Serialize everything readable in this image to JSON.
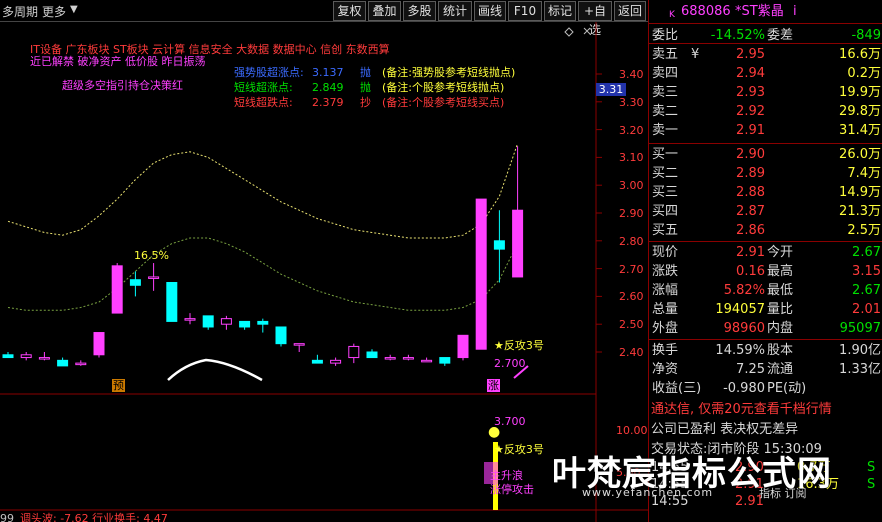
{
  "toolbar": {
    "period": "多周期",
    "more": "更多",
    "buttons": [
      "复权",
      "叠加",
      "多股",
      "统计",
      "画线",
      "F10",
      "标记",
      "+自选",
      "返回"
    ]
  },
  "chart": {
    "news_line1": "IT设备    广东板块  ST板块  云计算  信息安全  大数据  数据中心  信创  东数西算",
    "news_line2": "近已解禁  破净资产  低价股  昨日振荡",
    "indicator_tag": "超级多空指引持仓决策红",
    "levels": [
      {
        "label": "强势股超涨点:",
        "value": "3.137",
        "mark": "抛",
        "note": "(备注:强势股参考短线抛点)",
        "color": "#3b6bff"
      },
      {
        "label": "短线超涨点:",
        "value": "2.849",
        "mark": "抛",
        "note": "(备注:个股参考短线抛点)",
        "color": "#00e000"
      },
      {
        "label": "短线超跌点:",
        "value": "2.379",
        "mark": "抄",
        "note": "(备注:个股参考短线买点)",
        "color": "#ff3b3b"
      }
    ],
    "price_axis": [
      "3.40",
      "3.30",
      "3.20",
      "3.10",
      "3.00",
      "2.90",
      "2.80",
      "2.70",
      "2.60",
      "2.50",
      "2.40"
    ],
    "cursor_price": "3.31",
    "peak_label": "16.5%",
    "signal1": "反攻3号",
    "signal1_price": "2.700",
    "pre_tag": "预",
    "up_tag": "涨",
    "lower_axis": [
      "10.00",
      "5.00"
    ],
    "lower_price": "3.700",
    "lower_signal": "反攻3号",
    "lower_text1": "主升浪",
    "lower_text2": "涨停攻击",
    "footer": "调头波: -7.62  行业换手: 4.47",
    "footer_left": "99"
  },
  "chart_data": {
    "type": "candlestick",
    "ylim": [
      2.35,
      3.45
    ],
    "candles": [
      {
        "o": 2.39,
        "h": 2.4,
        "l": 2.38,
        "c": 2.38
      },
      {
        "o": 2.38,
        "h": 2.4,
        "l": 2.37,
        "c": 2.39
      },
      {
        "o": 2.38,
        "h": 2.4,
        "l": 2.37,
        "c": 2.38
      },
      {
        "o": 2.37,
        "h": 2.38,
        "l": 2.35,
        "c": 2.35
      },
      {
        "o": 2.36,
        "h": 2.37,
        "l": 2.35,
        "c": 2.36
      },
      {
        "o": 2.39,
        "h": 2.47,
        "l": 2.38,
        "c": 2.47
      },
      {
        "o": 2.54,
        "h": 2.72,
        "l": 2.54,
        "c": 2.71
      },
      {
        "o": 2.66,
        "h": 2.69,
        "l": 2.6,
        "c": 2.64
      },
      {
        "o": 2.67,
        "h": 2.72,
        "l": 2.62,
        "c": 2.67
      },
      {
        "o": 2.65,
        "h": 2.65,
        "l": 2.51,
        "c": 2.51
      },
      {
        "o": 2.52,
        "h": 2.54,
        "l": 2.5,
        "c": 2.52
      },
      {
        "o": 2.53,
        "h": 2.53,
        "l": 2.48,
        "c": 2.49
      },
      {
        "o": 2.5,
        "h": 2.53,
        "l": 2.48,
        "c": 2.52
      },
      {
        "o": 2.51,
        "h": 2.51,
        "l": 2.48,
        "c": 2.49
      },
      {
        "o": 2.51,
        "h": 2.52,
        "l": 2.47,
        "c": 2.5
      },
      {
        "o": 2.49,
        "h": 2.49,
        "l": 2.42,
        "c": 2.43
      },
      {
        "o": 2.43,
        "h": 2.43,
        "l": 2.4,
        "c": 2.43
      },
      {
        "o": 2.37,
        "h": 2.39,
        "l": 2.36,
        "c": 2.36
      },
      {
        "o": 2.36,
        "h": 2.38,
        "l": 2.35,
        "c": 2.37
      },
      {
        "o": 2.38,
        "h": 2.43,
        "l": 2.36,
        "c": 2.42
      },
      {
        "o": 2.4,
        "h": 2.41,
        "l": 2.38,
        "c": 2.38
      },
      {
        "o": 2.38,
        "h": 2.39,
        "l": 2.37,
        "c": 2.38
      },
      {
        "o": 2.38,
        "h": 2.39,
        "l": 2.37,
        "c": 2.38
      },
      {
        "o": 2.37,
        "h": 2.38,
        "l": 2.37,
        "c": 2.37
      },
      {
        "o": 2.38,
        "h": 2.38,
        "l": 2.35,
        "c": 2.36
      },
      {
        "o": 2.38,
        "h": 2.46,
        "l": 2.37,
        "c": 2.46
      },
      {
        "o": 2.41,
        "h": 2.95,
        "l": 2.41,
        "c": 2.95
      },
      {
        "o": 2.8,
        "h": 2.91,
        "l": 2.65,
        "c": 2.77
      },
      {
        "o": 2.67,
        "h": 3.14,
        "l": 2.67,
        "c": 2.91
      }
    ],
    "upper_band": [
      2.87,
      2.85,
      2.83,
      2.82,
      2.84,
      2.89,
      2.95,
      3.02,
      3.08,
      3.11,
      3.12,
      3.1,
      3.06,
      3.02,
      2.98,
      2.94,
      2.91,
      2.88,
      2.86,
      2.84,
      2.83,
      2.82,
      2.81,
      2.81,
      2.81,
      2.82,
      2.86,
      2.96,
      3.15
    ],
    "lower_band": [
      2.56,
      2.55,
      2.55,
      2.55,
      2.56,
      2.58,
      2.63,
      2.69,
      2.75,
      2.79,
      2.81,
      2.81,
      2.79,
      2.76,
      2.72,
      2.68,
      2.65,
      2.62,
      2.6,
      2.58,
      2.57,
      2.56,
      2.55,
      2.55,
      2.55,
      2.56,
      2.59,
      2.66,
      2.79
    ]
  },
  "quote": {
    "code": "688086",
    "name": "*ST紫晶",
    "rows": [
      {
        "l": "委比",
        "v": "-14.52%",
        "vc": "g",
        "l2": "委差",
        "v2": "-849",
        "v2c": "g"
      },
      {
        "l": "卖五",
        "v": "2.95",
        "vc": "r",
        "v2": "16.6万",
        "v2c": "y",
        "yen": "¥"
      },
      {
        "l": "卖四",
        "v": "2.94",
        "vc": "r",
        "v2": "0.2万",
        "v2c": "y"
      },
      {
        "l": "卖三",
        "v": "2.93",
        "vc": "r",
        "v2": "19.9万",
        "v2c": "y"
      },
      {
        "l": "卖二",
        "v": "2.92",
        "vc": "r",
        "v2": "29.8万",
        "v2c": "y"
      },
      {
        "l": "卖一",
        "v": "2.91",
        "vc": "r",
        "v2": "31.4万",
        "v2c": "y"
      },
      {
        "l": "买一",
        "v": "2.90",
        "vc": "r",
        "v2": "26.0万",
        "v2c": "y"
      },
      {
        "l": "买二",
        "v": "2.89",
        "vc": "r",
        "v2": "7.4万",
        "v2c": "y"
      },
      {
        "l": "买三",
        "v": "2.88",
        "vc": "r",
        "v2": "14.9万",
        "v2c": "y"
      },
      {
        "l": "买四",
        "v": "2.87",
        "vc": "r",
        "v2": "21.3万",
        "v2c": "y"
      },
      {
        "l": "买五",
        "v": "2.86",
        "vc": "r",
        "v2": "2.5万",
        "v2c": "y"
      },
      {
        "l": "现价",
        "v": "2.91",
        "vc": "r",
        "l2": "今开",
        "v2": "2.67",
        "v2c": "g"
      },
      {
        "l": "涨跌",
        "v": "0.16",
        "vc": "r",
        "l2": "最高",
        "v2": "3.15",
        "v2c": "r"
      },
      {
        "l": "涨幅",
        "v": "5.82%",
        "vc": "r",
        "l2": "最低",
        "v2": "2.67",
        "v2c": "g"
      },
      {
        "l": "总量",
        "v": "194057",
        "vc": "y",
        "l2": "量比",
        "v2": "2.01",
        "v2c": "r"
      },
      {
        "l": "外盘",
        "v": "98960",
        "vc": "r",
        "l2": "内盘",
        "v2": "95097",
        "v2c": "g"
      },
      {
        "l": "换手",
        "v": "14.59%",
        "vc": "w",
        "l2": "股本",
        "v2": "1.90亿",
        "v2c": "w"
      },
      {
        "l": "净资",
        "v": "7.25",
        "vc": "w",
        "l2": "流通",
        "v2": "1.33亿",
        "v2c": "w"
      },
      {
        "l": "收益(三)",
        "v": "-0.980",
        "vc": "w",
        "l2": "PE(动)",
        "v2": "",
        "v2c": "w"
      }
    ],
    "ad": "通达信, 仅需20元查看千档行情",
    "notice": "公司已盈利 表决权无差异",
    "status": "交易状态:闭市阶段 15:30:09",
    "ticks": [
      {
        "t": "14:55",
        "p": "2.90",
        "v": "0.7万",
        "f": "S"
      },
      {
        "t": "14:55",
        "p": "2.91",
        "v": "16.3万",
        "f": "S"
      },
      {
        "t": "14:55",
        "p": "2.91",
        "v": "",
        "f": ""
      }
    ],
    "tabs": "指标 订阅"
  },
  "watermark": {
    "title": "叶梵宸指标公式网",
    "url": "www.yefanchen.com"
  }
}
